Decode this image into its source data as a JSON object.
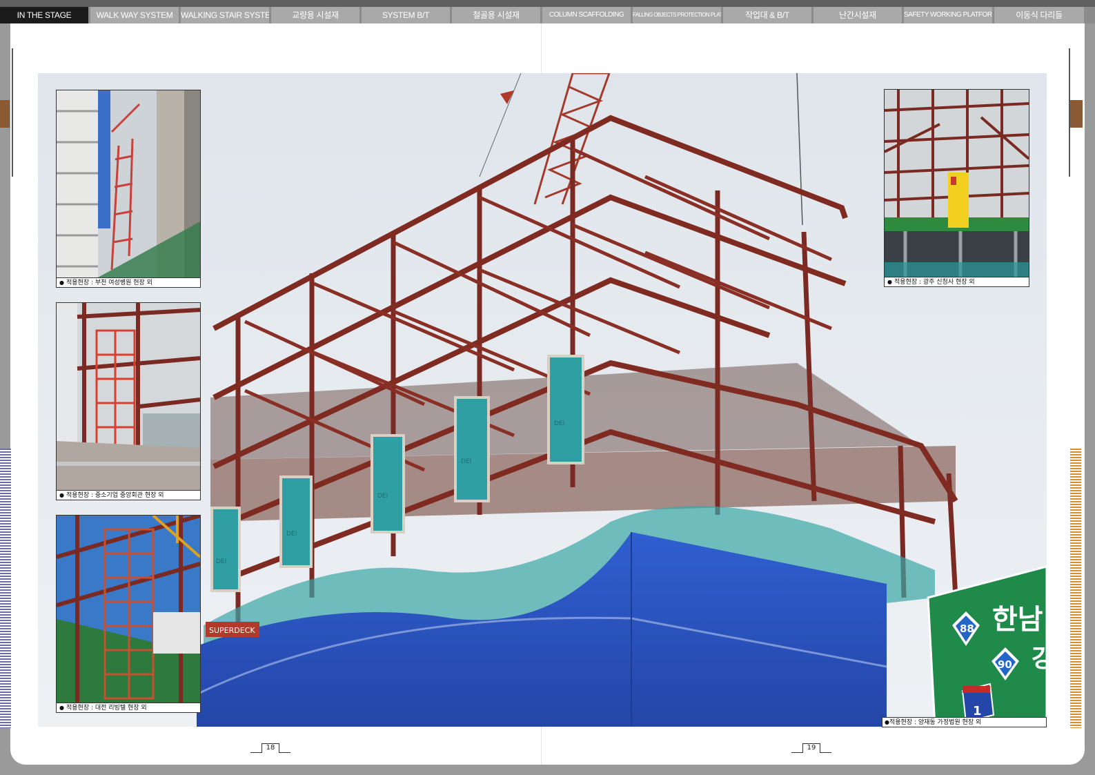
{
  "nav": {
    "tabs": [
      {
        "label": "IN THE STAGE",
        "active": true
      },
      {
        "label": "WALK WAY SYSTEM",
        "active": false
      },
      {
        "label": "WALKING STAIR SYSTEM",
        "active": false
      },
      {
        "label": "교량용 시설재",
        "active": false
      },
      {
        "label": "SYSTEM B/T",
        "active": false
      },
      {
        "label": "철골용 시설재",
        "active": false
      },
      {
        "label": "COLUMN SCAFFOLDING",
        "active": false
      },
      {
        "label": "FALLING OBJECTS PROTECTION PLATFORM",
        "active": false
      },
      {
        "label": "작업대 & B/T",
        "active": false
      },
      {
        "label": "난간시설재",
        "active": false
      },
      {
        "label": "SAFETY WORKING PLATFORM",
        "active": false
      },
      {
        "label": "이동식 다리들",
        "active": false
      }
    ]
  },
  "photos": {
    "inset_top_left": {
      "caption": "적용현장 : 부천 여성병원 현장 외"
    },
    "inset_mid_left": {
      "caption": "적용현장 : 중소기업 중앙회관 현장 외"
    },
    "inset_bottom_left": {
      "caption": "적용현장 : 대전 리빙텔 현장 외"
    },
    "inset_top_right": {
      "caption": "적용현장 : 광주 신청사 현장 외"
    },
    "main": {
      "caption": "적용현장 : 양재동 가정법원 현장 외",
      "road_sign": {
        "text": "한남",
        "text2": "강",
        "route_88": "88",
        "route_90": "90",
        "route_1": "1"
      },
      "deck_label": "SUPERDECK"
    }
  },
  "bullet": "●",
  "pages": {
    "left": "18",
    "right": "19"
  },
  "colors": {
    "active_tab": "#1b1b1b",
    "tab": "#a9a9a9",
    "steel": "#7a2a22",
    "net_blue": "#2b56c8",
    "net_teal": "#2f9fa4",
    "sign_green": "#1f8a4a"
  }
}
